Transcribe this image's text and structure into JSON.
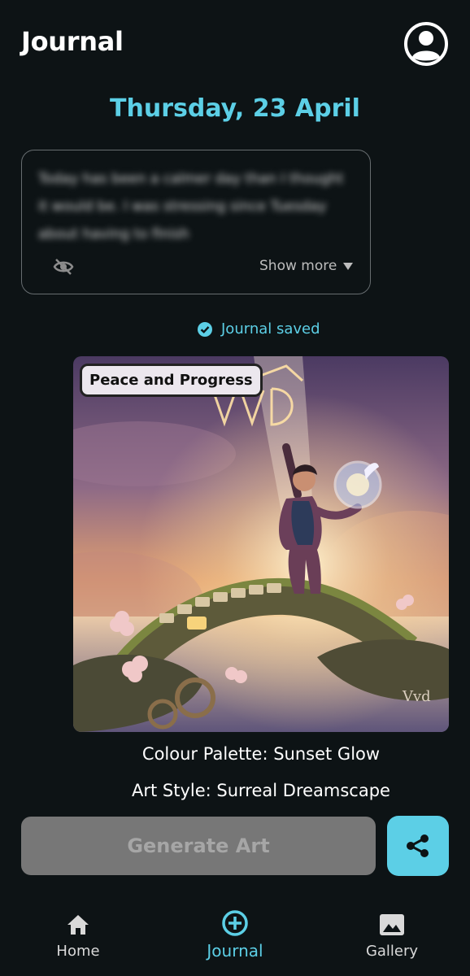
{
  "header": {
    "title": "Journal",
    "avatar_icon": "account-circle-icon"
  },
  "date": "Thursday, 23 April",
  "journal": {
    "preview_text": "Today has been a calmer day than I thought it would be. I was stressing since Tuesday about having to finish",
    "hide_icon": "eye-off-icon",
    "show_more_label": "Show more"
  },
  "saved_status": {
    "icon": "check-circle-icon",
    "label": "Journal saved"
  },
  "artwork": {
    "title": "Peace and Progress",
    "signature": "Vvd",
    "colour_palette": "Colour Palette: Sunset Glow",
    "art_style": "Art Style: Surreal Dreamscape"
  },
  "actions": {
    "generate_label": "Generate Art",
    "share_icon": "share-icon"
  },
  "nav": {
    "items": [
      {
        "label": "Home",
        "icon": "home-icon"
      },
      {
        "label": "Journal",
        "icon": "add-circle-icon",
        "active": true
      },
      {
        "label": "Gallery",
        "icon": "image-icon"
      }
    ]
  },
  "colors": {
    "accent": "#5ccfe6",
    "background": "#0d1315",
    "disabled_button": "#777777"
  }
}
